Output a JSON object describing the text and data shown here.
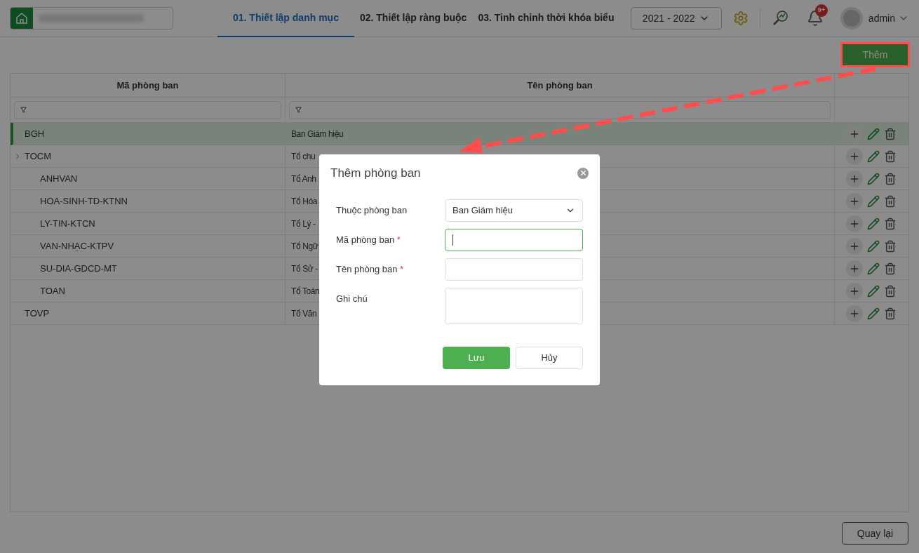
{
  "header": {
    "tabs": [
      {
        "label": "01. Thiết lập danh mục",
        "selected": true
      },
      {
        "label": "02. Thiết lập ràng buộc",
        "selected": false
      },
      {
        "label": "03. Tinh chỉnh thời khóa biểu",
        "selected": false
      }
    ],
    "year": "2021 - 2022",
    "notification_badge": "9+",
    "user": "admin"
  },
  "toolbar": {
    "add_button": "Thêm"
  },
  "table": {
    "columns": [
      "Mã phòng ban",
      "Tên phòng ban"
    ],
    "rows": [
      {
        "code": "BGH",
        "name": "Ban Giám hiệu",
        "selected": true
      },
      {
        "code": "TOCM",
        "name": "Tổ chu",
        "selected": false,
        "children": [
          {
            "code": "ANHVAN",
            "name": "Tổ Anh",
            "selected": false
          },
          {
            "code": "HOA-SINH-TD-KTNN",
            "name": "Tổ Hóa",
            "selected": false
          },
          {
            "code": "LY-TIN-KTCN",
            "name": "Tổ Lý -",
            "selected": false
          },
          {
            "code": "VAN-NHẠC-KTPV",
            "name": "Tổ Ngữ",
            "selected": false
          },
          {
            "code": "SU-DIA-GDCD-MT",
            "name": "Tổ Sử -",
            "selected": false
          },
          {
            "code": "TOAN",
            "name": "Tổ Toán",
            "selected": false
          }
        ]
      },
      {
        "code": "TOVP",
        "name": "Tổ Văn",
        "selected": false
      }
    ]
  },
  "back_button": "Quay lại",
  "dialog": {
    "title": "Thêm phòng ban",
    "fields": [
      {
        "kind": "select",
        "label": "Thuộc phòng ban",
        "required": false,
        "value": "Ban Giám hiệu",
        "focused": false
      },
      {
        "kind": "input",
        "label": "Mã phòng ban",
        "required": true,
        "focused": true
      },
      {
        "kind": "input",
        "label": "Tên phòng ban",
        "required": true,
        "focused": false
      },
      {
        "kind": "textarea",
        "label": "Ghi chú",
        "required": false,
        "focused": false
      }
    ],
    "required_mark": "*",
    "save": "Lưu",
    "cancel": "Hủy"
  }
}
